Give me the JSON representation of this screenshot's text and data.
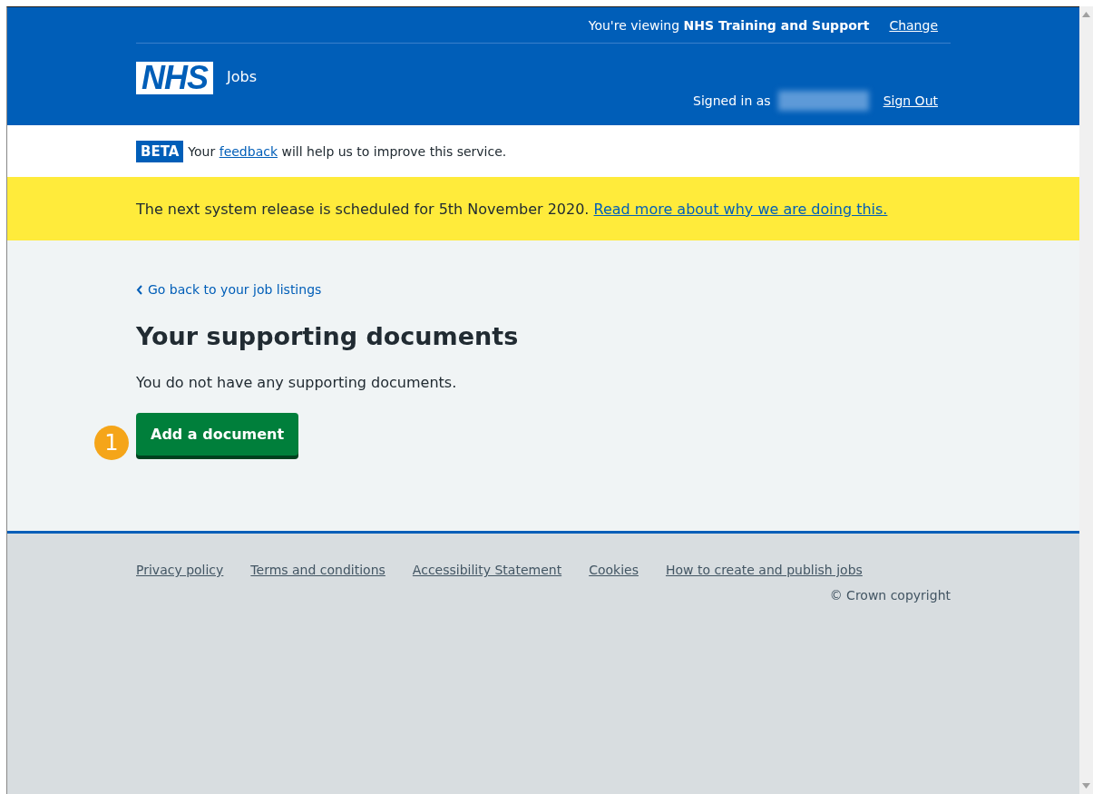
{
  "header": {
    "viewing_prefix": "You're viewing",
    "organisation": "NHS Training and Support",
    "change_link": "Change",
    "logo": "NHS",
    "service_name": "Jobs",
    "signed_in_label": "Signed in as",
    "sign_out_link": "Sign Out"
  },
  "beta_banner": {
    "tag": "BETA",
    "text_before": "Your",
    "link": "feedback",
    "text_after": "will help us to improve this service."
  },
  "notice": {
    "text": "The next system release is scheduled for 5th November 2020.",
    "link": "Read more about why we are doing this."
  },
  "back_link": "Go back to your job listings",
  "heading": "Your supporting documents",
  "body": "You do not have any supporting documents.",
  "step_marker": "1",
  "add_button": "Add a document",
  "footer": {
    "links": [
      "Privacy policy",
      "Terms and conditions",
      "Accessibility Statement",
      "Cookies",
      "How to create and publish jobs"
    ],
    "copyright": "© Crown copyright"
  }
}
